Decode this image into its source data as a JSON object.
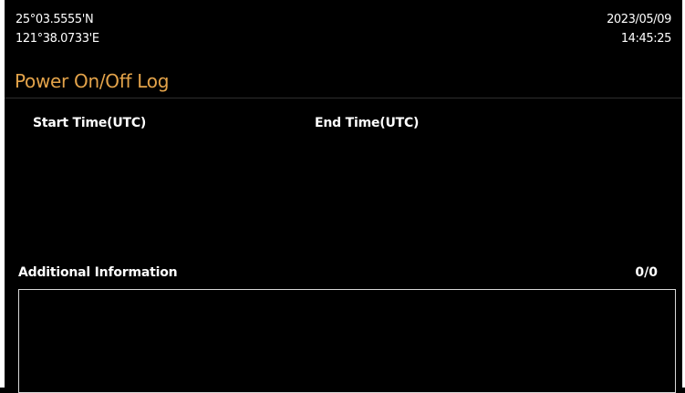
{
  "status": {
    "latitude": "25°03.5555'N",
    "longitude": "121°38.0733'E",
    "date": "2023/05/09",
    "time": "14:45:25"
  },
  "page": {
    "title": "Power On/Off Log"
  },
  "log_table": {
    "columns": [
      "Start Time(UTC)",
      "End Time(UTC)"
    ],
    "rows": []
  },
  "additional_info": {
    "label": "Additional Information",
    "count": "0/0",
    "text": ""
  },
  "colors": {
    "background": "#000000",
    "title": "#e3a34a",
    "text": "#ffffff",
    "box_border": "#d8d8d8"
  }
}
